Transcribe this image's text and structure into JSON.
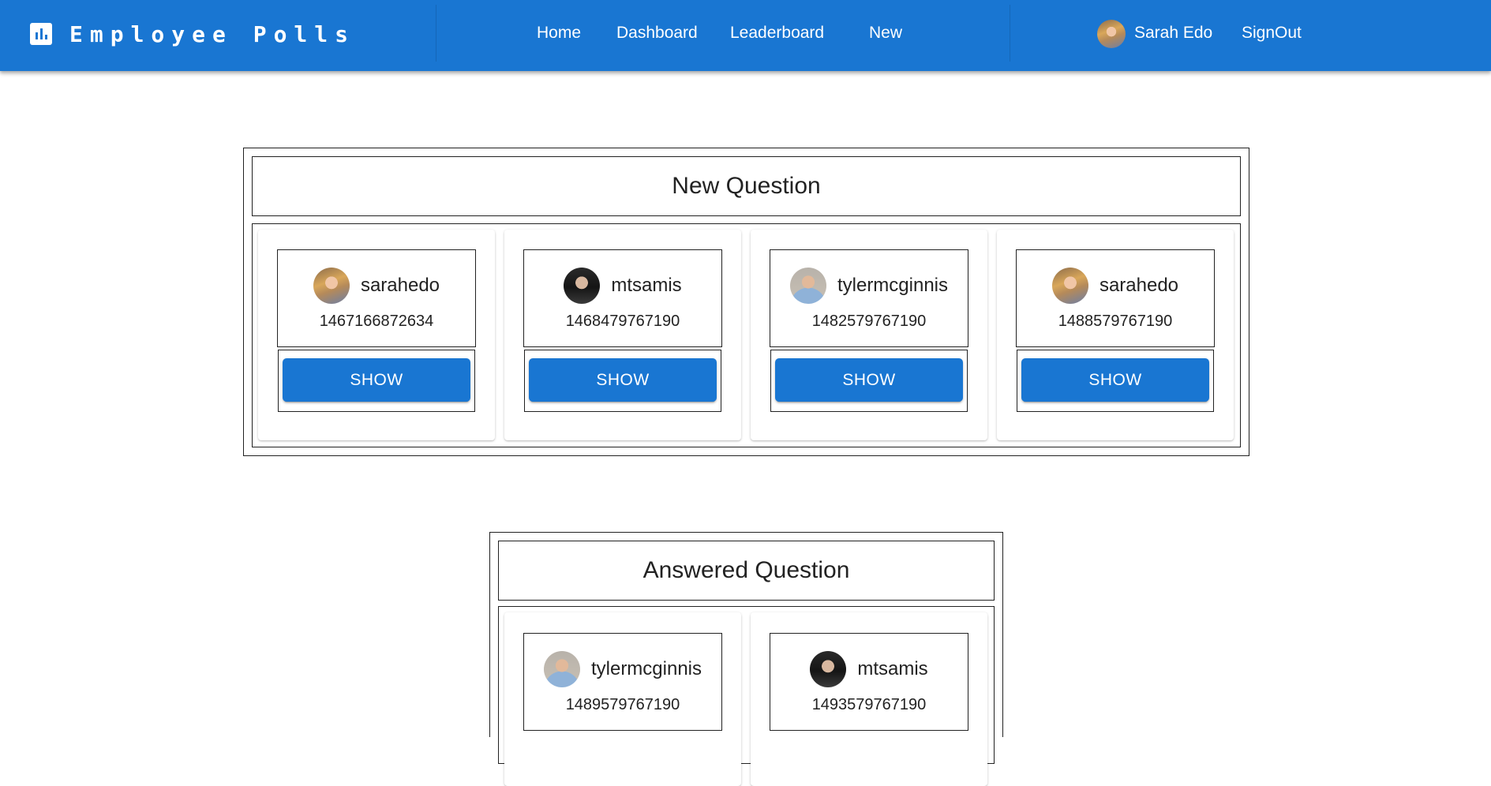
{
  "header": {
    "brand_title": "Employee Polls",
    "brand_icon": "poll-chart-icon",
    "nav": [
      "Home",
      "Dashboard",
      "Leaderboard",
      "New"
    ],
    "user": {
      "name": "Sarah Edo",
      "avatar": "avatar-sarahedo"
    },
    "signout_label": "SignOut",
    "color": "#1976d2"
  },
  "new_questions": {
    "title": "New Question",
    "cards": [
      {
        "author": "sarahedo",
        "timestamp": "1467166872634",
        "button": "SHOW"
      },
      {
        "author": "mtsamis",
        "timestamp": "1468479767190",
        "button": "SHOW"
      },
      {
        "author": "tylermcginnis",
        "timestamp": "1482579767190",
        "button": "SHOW"
      },
      {
        "author": "sarahedo",
        "timestamp": "1488579767190",
        "button": "SHOW"
      }
    ]
  },
  "answered_questions": {
    "title": "Answered Question",
    "cards": [
      {
        "author": "tylermcginnis",
        "timestamp": "1489579767190"
      },
      {
        "author": "mtsamis",
        "timestamp": "1493579767190"
      }
    ]
  }
}
